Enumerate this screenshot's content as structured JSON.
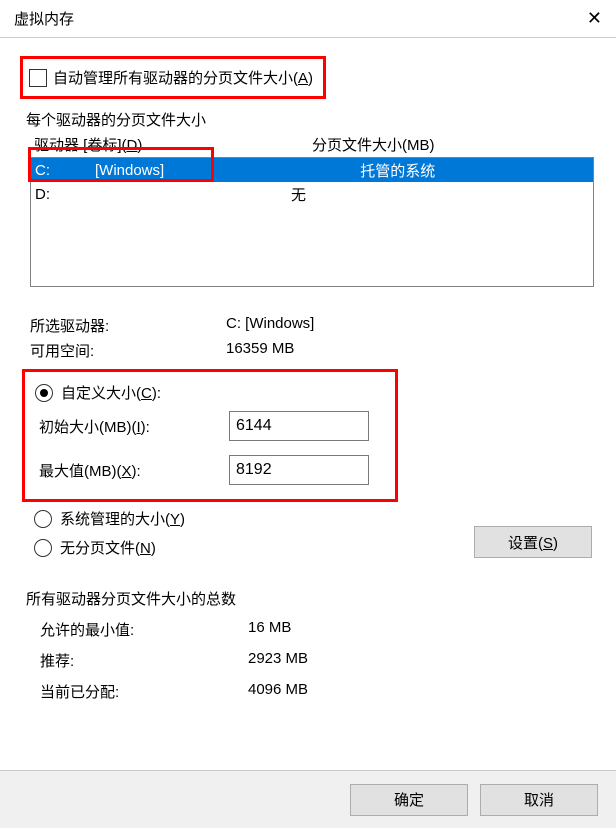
{
  "window": {
    "title": "虚拟内存"
  },
  "auto_manage": {
    "label_pre": "自动管理所有驱动器的分页文件大小(",
    "accel": "A",
    "label_post": ")",
    "checked": false
  },
  "per_drive_header": "每个驱动器的分页文件大小",
  "columns": {
    "drive_pre": "驱动器 [卷标](",
    "drive_accel": "D",
    "drive_post": ")",
    "size": "分页文件大小(MB)"
  },
  "drives": [
    {
      "letter": "C:",
      "label": "[Windows]",
      "size": "托管的系统",
      "selected": true
    },
    {
      "letter": "D:",
      "label": "",
      "size": "无",
      "selected": false
    }
  ],
  "selected_info": {
    "drive_label": "所选驱动器:",
    "drive_value": "C:  [Windows]",
    "space_label": "可用空间:",
    "space_value": "16359 MB"
  },
  "custom": {
    "radio_pre": "自定义大小(",
    "radio_accel": "C",
    "radio_post": "):",
    "initial_pre": "初始大小(MB)(",
    "initial_accel": "I",
    "initial_post": "):",
    "initial_value": "6144",
    "max_pre": "最大值(MB)(",
    "max_accel": "X",
    "max_post": "):",
    "max_value": "8192"
  },
  "system_managed": {
    "pre": "系统管理的大小(",
    "accel": "Y",
    "post": ")"
  },
  "no_page": {
    "pre": "无分页文件(",
    "accel": "N",
    "post": ")"
  },
  "set_btn": {
    "pre": "设置(",
    "accel": "S",
    "post": ")"
  },
  "totals": {
    "title": "所有驱动器分页文件大小的总数",
    "min_label": "允许的最小值:",
    "min_value": "16 MB",
    "rec_label": "推荐:",
    "rec_value": "2923 MB",
    "cur_label": "当前已分配:",
    "cur_value": "4096 MB"
  },
  "footer": {
    "ok": "确定",
    "cancel": "取消"
  }
}
